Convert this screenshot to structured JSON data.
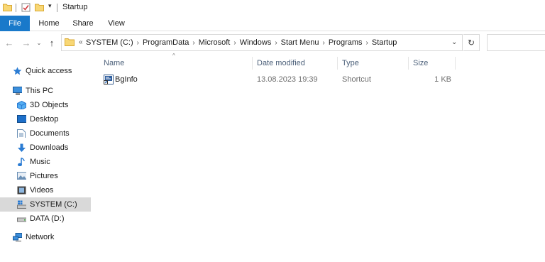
{
  "window": {
    "title": "Startup"
  },
  "ribbon": {
    "tabs": [
      {
        "label": "File"
      },
      {
        "label": "Home"
      },
      {
        "label": "Share"
      },
      {
        "label": "View"
      }
    ]
  },
  "address": {
    "ellipsis": "«",
    "crumbs": [
      "SYSTEM (C:)",
      "ProgramData",
      "Microsoft",
      "Windows",
      "Start Menu",
      "Programs",
      "Startup"
    ]
  },
  "nav_pane": {
    "items": [
      {
        "label": "Quick access",
        "icon": "star-icon"
      },
      {
        "label": "This PC",
        "icon": "computer-icon"
      },
      {
        "label": "3D Objects",
        "icon": "cube-icon"
      },
      {
        "label": "Desktop",
        "icon": "desktop-icon"
      },
      {
        "label": "Documents",
        "icon": "document-icon"
      },
      {
        "label": "Downloads",
        "icon": "download-arrow-icon"
      },
      {
        "label": "Music",
        "icon": "music-note-icon"
      },
      {
        "label": "Pictures",
        "icon": "pictures-icon"
      },
      {
        "label": "Videos",
        "icon": "film-icon"
      },
      {
        "label": "SYSTEM (C:)",
        "icon": "windows-drive-icon",
        "selected": true
      },
      {
        "label": "DATA (D:)",
        "icon": "drive-icon"
      },
      {
        "label": "Network",
        "icon": "network-icon"
      }
    ]
  },
  "columns": {
    "name": "Name",
    "date": "Date modified",
    "type": "Type",
    "size": "Size"
  },
  "files": [
    {
      "name": "BgInfo",
      "date": "13.08.2023 19:39",
      "type": "Shortcut",
      "size": "1 KB",
      "icon": "bginfo-shortcut-icon"
    }
  ],
  "colors": {
    "accent": "#1979ca",
    "selected_bg": "#d9d9d9",
    "folder": "#f8d775"
  }
}
